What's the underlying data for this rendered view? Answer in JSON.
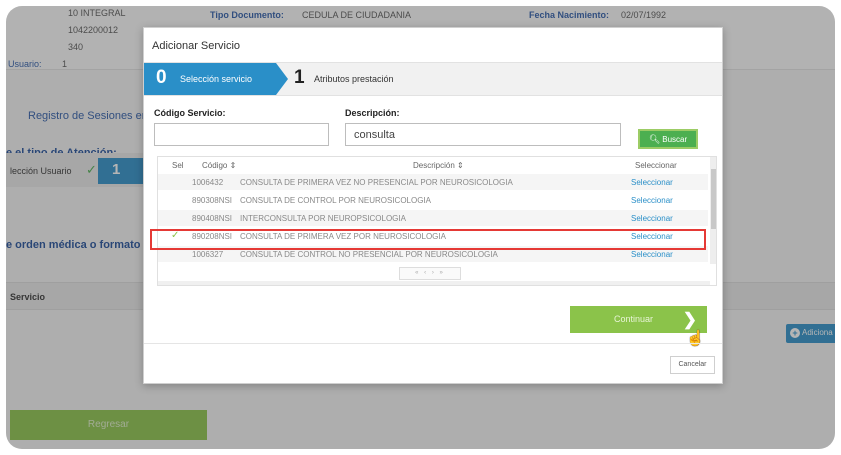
{
  "background": {
    "header": {
      "row1_left": "10 INTEGRAL",
      "row2_left": "1042200012",
      "row3_left": "340",
      "usuario_label": "Usuario:",
      "usuario_value": "1",
      "tipo_documento_label": "Tipo Documento:",
      "tipo_documento_value": "CEDULA DE CIUDADANIA",
      "fecha_nacimiento_label": "Fecha Nacimiento:",
      "fecha_nacimiento_value": "02/07/1992"
    },
    "registro_sesiones": "Registro de Sesiones en",
    "tipo_atencion": "e el tipo de Atención:",
    "step_label": "lección Usuario",
    "step_number": "1",
    "orden_medica": "e orden médica o formato",
    "servicio_header": "Servicio",
    "adicionar_button": "Adiciona",
    "regresar_button": "Regresar"
  },
  "modal": {
    "title": "Adicionar Servicio",
    "steps": [
      {
        "number": "0",
        "label": "Selección servicio"
      },
      {
        "number": "1",
        "label": "Atributos prestación"
      }
    ],
    "codigo_label": "Código Servicio:",
    "codigo_value": "",
    "descripcion_label": "Descripción:",
    "descripcion_value": "consulta",
    "buscar_button": "Buscar",
    "grid": {
      "columns": {
        "sel": "Sel",
        "codigo": "Código",
        "descripcion": "Descripción",
        "seleccionar": "Seleccionar"
      },
      "rows": [
        {
          "sel": "",
          "codigo": "1006432",
          "descripcion": "CONSULTA DE PRIMERA VEZ NO PRESENCIAL POR NEUROSICOLOGIA",
          "action": "Seleccionar"
        },
        {
          "sel": "",
          "codigo": "890308NSI",
          "descripcion": "CONSULTA DE CONTROL POR NEUROSICOLOGIA",
          "action": "Seleccionar"
        },
        {
          "sel": "",
          "codigo": "890408NSI",
          "descripcion": "INTERCONSULTA POR NEUROPSICOLOGIA",
          "action": "Seleccionar"
        },
        {
          "sel": "✓",
          "codigo": "890208NSI",
          "descripcion": "CONSULTA DE PRIMERA VEZ POR NEUROSICOLOGIA",
          "action": "Seleccionar"
        },
        {
          "sel": "",
          "codigo": "1006327",
          "descripcion": "CONSULTA DE CONTROL NO PRESENCIAL POR NEUROSICOLOGIA",
          "action": "Seleccionar"
        }
      ],
      "selected_index": 3
    },
    "pager": "« ‹ › »",
    "continuar_button": "Continuar",
    "cancelar_button": "Cancelar"
  },
  "colors": {
    "accent": "#2a8fc8",
    "green": "#4caf50",
    "light_green": "#8bc34a",
    "highlight": "#e53935"
  }
}
